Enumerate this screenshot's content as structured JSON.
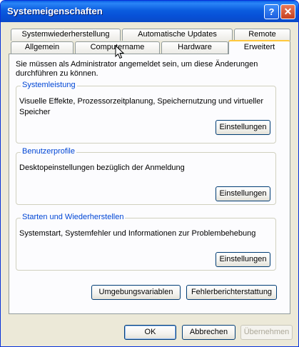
{
  "window": {
    "title": "Systemeigenschaften"
  },
  "titlebar": {
    "help_glyph": "?",
    "close_glyph": "✕"
  },
  "tabs_row1": [
    "Systemwiederherstellung",
    "Automatische Updates",
    "Remote"
  ],
  "tabs_row2": [
    "Allgemein",
    "Computername",
    "Hardware",
    "Erweitert"
  ],
  "active_tab": "Erweitert",
  "intro": "Sie müssen als Administrator angemeldet sein, um diese Änderungen durchführen zu können.",
  "groups": {
    "performance": {
      "label": "Systemleistung",
      "description": "Visuelle Effekte, Prozessorzeitplanung, Speichernutzung und virtueller Speicher",
      "button": "Einstellungen"
    },
    "profiles": {
      "label": "Benutzerprofile",
      "description": "Desktopeinstellungen bezüglich der Anmeldung",
      "button": "Einstellungen"
    },
    "startup": {
      "label": "Starten und Wiederherstellen",
      "description": "Systemstart, Systemfehler und Informationen zur Problembehebung",
      "button": "Einstellungen"
    }
  },
  "panel_buttons": {
    "env_vars": "Umgebungsvariablen",
    "error_reporting": "Fehlerberichterstattung"
  },
  "dialog_buttons": {
    "ok": "OK",
    "cancel": "Abbrechen",
    "apply": "Übernehmen"
  }
}
